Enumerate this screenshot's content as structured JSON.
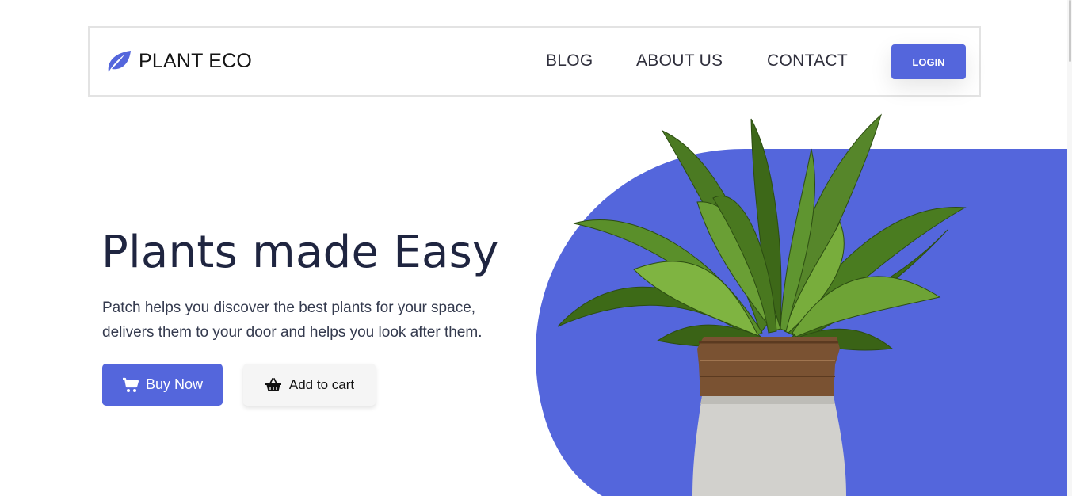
{
  "brand": {
    "name": "PLANT ECO",
    "icon": "leaf-icon"
  },
  "nav": {
    "links": [
      "BLOG",
      "ABOUT US",
      "CONTACT"
    ],
    "login_label": "LOGIN"
  },
  "hero": {
    "title": "Plants made Easy",
    "description": "Patch helps you discover the best plants for your space, delivers them to your door and helps you look after them.",
    "buy_label": "Buy Now",
    "buy_icon": "cart-icon",
    "cart_label": "Add to cart",
    "cart_icon": "basket-icon",
    "image": "potted-plant"
  },
  "colors": {
    "accent": "#5466dc",
    "heading": "#1f2540",
    "text": "#343a4e"
  }
}
